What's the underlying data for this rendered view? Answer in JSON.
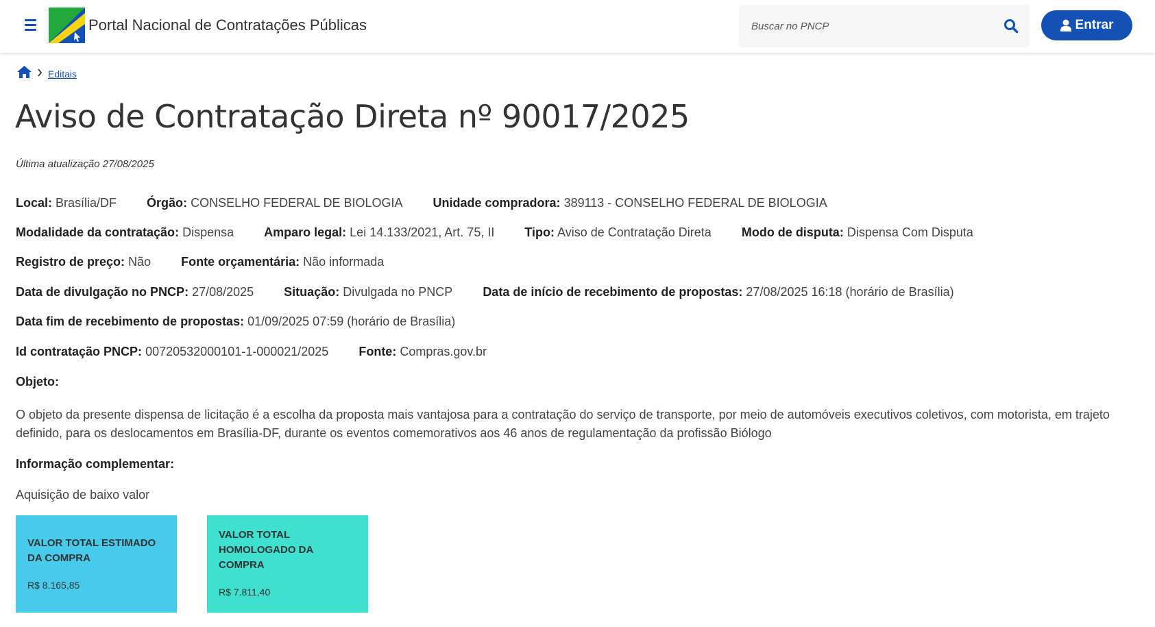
{
  "header": {
    "site_title": "Portal Nacional de Contratações Públicas",
    "search_placeholder": "Buscar no PNCP",
    "login_label": "Entrar"
  },
  "icons": {
    "menu": "menu-icon",
    "search": "search-icon",
    "user": "user-icon",
    "home": "home-icon",
    "chevron": "chevron-right-icon"
  },
  "colors": {
    "primary": "#1351b4",
    "card_estimado": "#48cbeb",
    "card_homologado": "#40e0d0",
    "logo_green": "#22a83b",
    "logo_yellow": "#f8d312",
    "logo_blue": "#1351b4"
  },
  "breadcrumb": {
    "item": "Editais"
  },
  "page": {
    "title": "Aviso de Contratação Direta nº 90017/2025",
    "last_update": "Última atualização 27/08/2025"
  },
  "details": {
    "row1": [
      {
        "label": "Local",
        "value": "Brasília/DF"
      },
      {
        "label": "Órgão",
        "value": "CONSELHO FEDERAL DE BIOLOGIA"
      },
      {
        "label": "Unidade compradora",
        "value": "389113 - CONSELHO FEDERAL DE BIOLOGIA"
      }
    ],
    "row2": [
      {
        "label": "Modalidade da contratação",
        "value": "Dispensa"
      },
      {
        "label": "Amparo legal",
        "value": "Lei 14.133/2021, Art. 75, II"
      },
      {
        "label": "Tipo",
        "value": "Aviso de Contratação Direta"
      },
      {
        "label": "Modo de disputa",
        "value": "Dispensa Com Disputa"
      }
    ],
    "row3": [
      {
        "label": "Registro de preço",
        "value": "Não"
      },
      {
        "label": "Fonte orçamentária",
        "value": "Não informada"
      }
    ],
    "row4": [
      {
        "label": "Data de divulgação no PNCP",
        "value": "27/08/2025"
      },
      {
        "label": "Situação",
        "value": "Divulgada no PNCP"
      },
      {
        "label": "Data de início de recebimento de propostas",
        "value": "27/08/2025 16:18 (horário de Brasília)"
      }
    ],
    "row5": [
      {
        "label": "Data fim de recebimento de propostas",
        "value": "01/09/2025 07:59 (horário de Brasília)"
      }
    ],
    "row6": [
      {
        "label": "Id contratação PNCP",
        "value": "00720532000101-1-000021/2025"
      },
      {
        "label": "Fonte",
        "value": "Compras.gov.br"
      }
    ]
  },
  "objeto": {
    "label": "Objeto",
    "text": "O objeto da presente dispensa de licitação é a escolha da proposta mais vantajosa para a contratação do serviço de transporte, por meio de automóveis executivos coletivos, com motorista, em trajeto definido, para os deslocamentos em Brasília-DF, durante os eventos comemorativos aos 46 anos de regulamentação da profissão Biólogo"
  },
  "info": {
    "label": "Informação complementar",
    "text": "Aquisição de baixo valor"
  },
  "cards": {
    "estimado": {
      "title": "VALOR TOTAL ESTIMADO DA COMPRA",
      "value": "R$ 8.165,85"
    },
    "homologado": {
      "title": "VALOR TOTAL HOMOLOGADO DA COMPRA",
      "value": "R$ 7.811,40"
    }
  }
}
